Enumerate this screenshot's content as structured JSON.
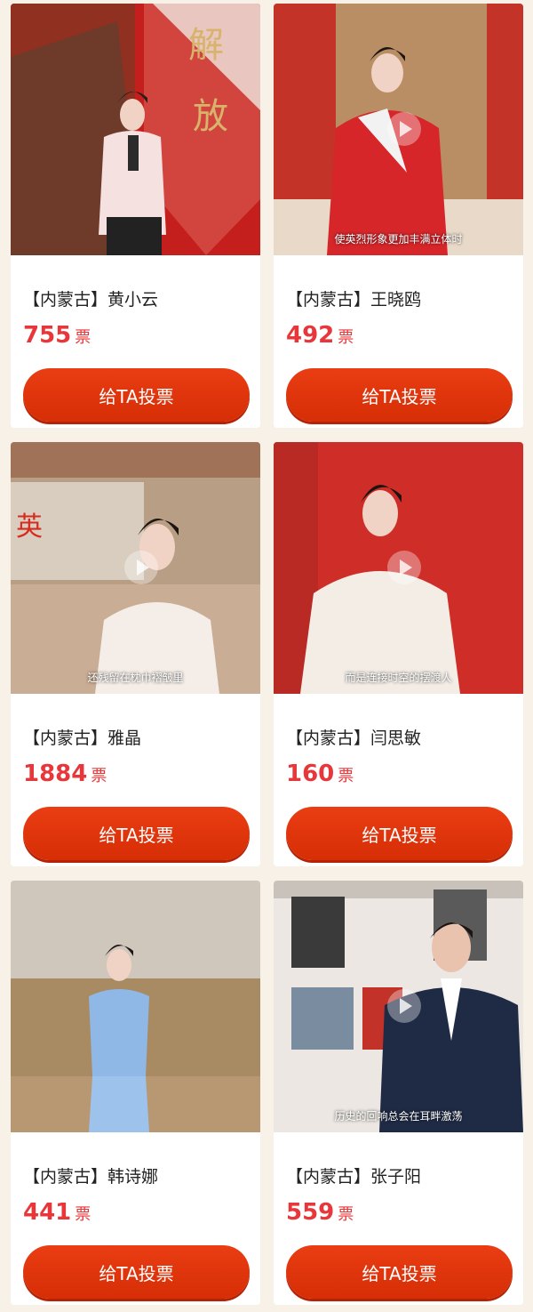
{
  "button_label": "给TA投票",
  "vote_unit": "票",
  "colors": {
    "background": "#f8f1e8",
    "accent": "#d9320a",
    "vote_count": "#e8373a"
  },
  "candidates": [
    {
      "name": "【内蒙古】黄小云",
      "votes": "755",
      "caption": ""
    },
    {
      "name": "【内蒙古】王晓鸥",
      "votes": "492",
      "caption": "使英烈形象更加丰满立体时"
    },
    {
      "name": "【内蒙古】雅晶",
      "votes": "1884",
      "caption": "还残留在枕巾褶皱里"
    },
    {
      "name": "【内蒙古】闫思敏",
      "votes": "160",
      "caption": "而是连接时空的摆渡人"
    },
    {
      "name": "【内蒙古】韩诗娜",
      "votes": "441",
      "caption": ""
    },
    {
      "name": "【内蒙古】张子阳",
      "votes": "559",
      "caption": "历史的回响总会在耳畔激荡"
    }
  ]
}
